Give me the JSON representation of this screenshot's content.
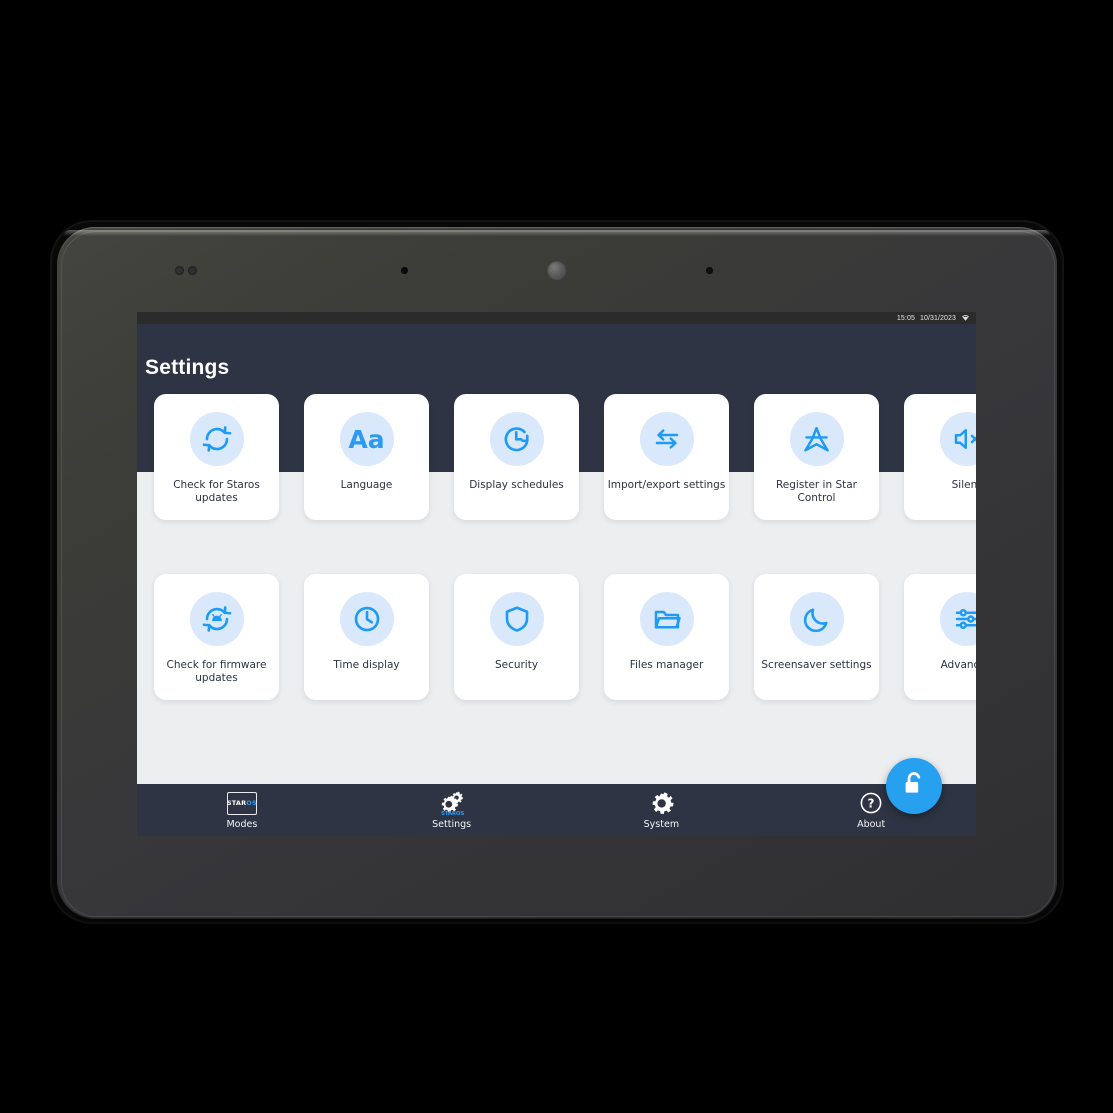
{
  "device": {
    "name": "tablet-device",
    "camera": "front-camera",
    "sensors": "proximity-sensors"
  },
  "status_bar": {
    "time": "15:05",
    "date": "10/31/2023",
    "wifi_icon": "wifi-icon"
  },
  "header": {
    "title": "Settings"
  },
  "tiles": {
    "row1": [
      {
        "label": "Check for Staros\nupdates",
        "icon": "refresh-circle-icon",
        "name": "tile-check-for-staros-updates"
      },
      {
        "label": "Language",
        "icon": "aa-text-icon",
        "name": "tile-language"
      },
      {
        "label": "Display schedules",
        "icon": "clock-refresh-icon",
        "name": "tile-display-schedules"
      },
      {
        "label": "Import/export settings",
        "icon": "exchange-arrows-icon",
        "name": "tile-import-export-settings"
      },
      {
        "label": "Register in Star Control",
        "icon": "star-icon",
        "name": "tile-register-in-star-control"
      },
      {
        "label": "Silent",
        "icon": "silent-icon",
        "name": "tile-silent"
      }
    ],
    "row2": [
      {
        "label": "Check for firmware\nupdates",
        "icon": "android-refresh-icon",
        "name": "tile-check-for-firmware-updates"
      },
      {
        "label": "Time display",
        "icon": "clock-icon",
        "name": "tile-time-display"
      },
      {
        "label": "Security",
        "icon": "shield-icon",
        "name": "tile-security"
      },
      {
        "label": "Files manager",
        "icon": "folder-open-icon",
        "name": "tile-files-manager"
      },
      {
        "label": "Screensaver settings",
        "icon": "moon-icon",
        "name": "tile-screensaver-settings"
      },
      {
        "label": "Advanced",
        "icon": "advanced-icon",
        "name": "tile-advanced"
      }
    ]
  },
  "bottom_nav": [
    {
      "label": "Modes",
      "icon": "staros-box-icon"
    },
    {
      "label": "Settings",
      "icon": "gears-icon"
    },
    {
      "label": "System",
      "icon": "gear-icon"
    },
    {
      "label": "About",
      "icon": "question-circle-icon"
    }
  ],
  "modes_logo": {
    "part1": "STAR",
    "part2": "OS"
  },
  "settings_gear_logo": "STAROS",
  "fab": {
    "icon": "unlock-icon",
    "name": "unlock-button"
  },
  "colors": {
    "header": "#2e3443",
    "accent": "#2b9af3",
    "fab": "#27a0f0",
    "content_bg": "#eceef0",
    "tile_bg": "#ffffff",
    "icon_bg": "#d9e9fb",
    "status_bar": "#2b2b2b"
  }
}
